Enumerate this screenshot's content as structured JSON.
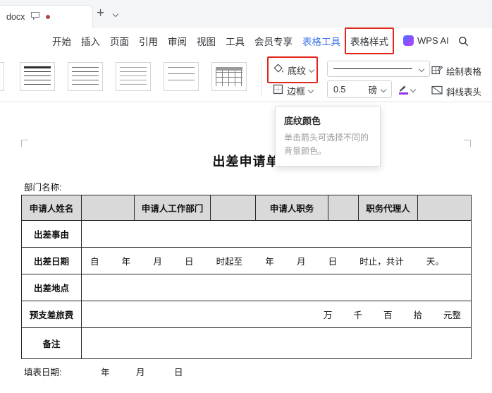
{
  "tabbar": {
    "doc_title": "docx",
    "new_tab_label": "+"
  },
  "menubar": {
    "items": [
      "开始",
      "插入",
      "页面",
      "引用",
      "审阅",
      "视图",
      "工具",
      "会员专享"
    ],
    "table_tools": "表格工具",
    "table_style": "表格样式",
    "wps_ai": "WPS AI"
  },
  "toolbar": {
    "shading_label": "底纹",
    "border_label": "边框",
    "line_weight_value": "0.5",
    "line_weight_unit": "磅",
    "draw_table_label": "绘制表格",
    "diagonal_header_label": "斜线表头"
  },
  "tooltip": {
    "title": "底纹颜色",
    "body": "单击箭头可选择不同的背景颜色。"
  },
  "document": {
    "title": "出差申请单",
    "department_label": "部门名称:",
    "table": {
      "header_row": [
        "申请人姓名",
        "",
        "申请人工作部门",
        "",
        "申请人职务",
        "",
        "职务代理人",
        ""
      ],
      "row_labels": [
        "出差事由",
        "出差日期",
        "出差地点",
        "预支差旅费",
        "备注"
      ],
      "date_tokens": [
        "自",
        "年",
        "月",
        "日",
        "时起至",
        "年",
        "月",
        "日",
        "时止，共计",
        "天。"
      ],
      "expense_tokens": [
        "万",
        "千",
        "百",
        "拾",
        "元整"
      ]
    },
    "footer_label": "填表日期:",
    "footer_tokens": [
      "年",
      "月",
      "日"
    ]
  },
  "icons": {
    "shading": "paint-bucket",
    "border": "grid-border",
    "line_style": "horizontal-line",
    "line_color": "pen-purple",
    "draw_table": "pencil-table",
    "diagonal_header": "diagonal-line",
    "search": "magnifier",
    "comment": "speech-bubble",
    "wps_ai": "gradient-badge",
    "unsaved": "red-dot"
  },
  "colors": {
    "accent_blue": "#3b74e8",
    "annotation_red": "#e1251b",
    "table_header_bg": "#d9d9d9",
    "line_color_swatch": "#9333ea"
  }
}
